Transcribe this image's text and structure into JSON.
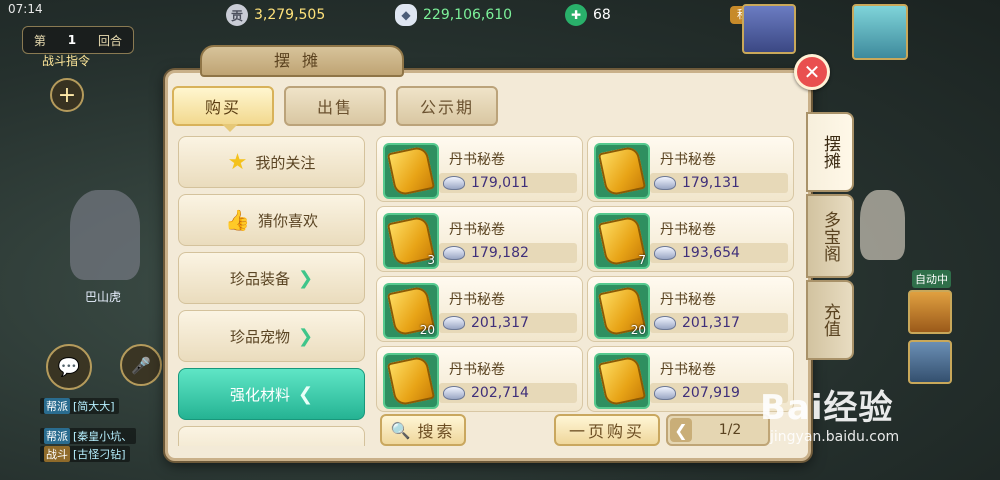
{
  "status": {
    "time": "07:14"
  },
  "currencies": [
    {
      "icon": "silver-coin-icon",
      "value": "3,279,505"
    },
    {
      "icon": "silver-ingot-icon",
      "value": "229,106,610"
    },
    {
      "icon": "jade-icon",
      "value": "68"
    }
  ],
  "hud": {
    "round_prefix": "第",
    "round_number": "1",
    "round_suffix": "回合",
    "battle_command": "战斗指令",
    "points_badge": "积分",
    "npc_name": "巴山虎",
    "auto_label": "自动中",
    "chat": [
      {
        "tag": "帮派",
        "text": "[简大大]"
      },
      {
        "tag": "帮派",
        "text": "[秦皇小坑、"
      },
      {
        "tag": "战斗",
        "text": "[古怪刁钻]"
      }
    ]
  },
  "panel": {
    "title": "摆摊",
    "tabs": [
      "购买",
      "出售",
      "公示期"
    ],
    "active_tab": 0,
    "categories": [
      {
        "label": "我的关注",
        "icon": "star-icon"
      },
      {
        "label": "猜你喜欢",
        "icon": "thumbs-up-icon"
      },
      {
        "label": "珍品装备",
        "icon": "chevron-right-icon"
      },
      {
        "label": "珍品宠物",
        "icon": "chevron-right-icon"
      },
      {
        "label": "强化材料",
        "icon": "chevron-left-icon"
      }
    ],
    "active_category": 4,
    "items": [
      {
        "name": "丹书秘卷",
        "price": "179,011",
        "qty": ""
      },
      {
        "name": "丹书秘卷",
        "price": "179,131",
        "qty": ""
      },
      {
        "name": "丹书秘卷",
        "price": "179,182",
        "qty": "3"
      },
      {
        "name": "丹书秘卷",
        "price": "193,654",
        "qty": "7"
      },
      {
        "name": "丹书秘卷",
        "price": "201,317",
        "qty": "20"
      },
      {
        "name": "丹书秘卷",
        "price": "201,317",
        "qty": "20"
      },
      {
        "name": "丹书秘卷",
        "price": "202,714",
        "qty": ""
      },
      {
        "name": "丹书秘卷",
        "price": "207,919",
        "qty": ""
      }
    ],
    "search_label": "搜索",
    "buy_page_label": "一页购买",
    "pager": "1/2",
    "side_tabs": [
      "摆摊",
      "多宝阁",
      "充值"
    ]
  },
  "watermark": {
    "brand": "Bai经验",
    "url": "jingyan.baidu.com"
  }
}
